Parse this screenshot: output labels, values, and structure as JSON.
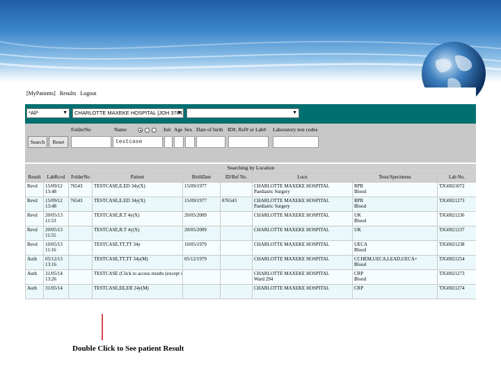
{
  "menu": {
    "items": [
      "[MyPatients]",
      "Results",
      "Logout"
    ]
  },
  "filters": {
    "status_select": "*All*",
    "hospital_select": "CHARLOTTE MAXEKE HOSPITAL [JOH 3784]",
    "third_select": ""
  },
  "search_form": {
    "labels": {
      "folder": "FolderNo",
      "name": "Name",
      "init": "Init",
      "age": "Age",
      "sex": "Sex",
      "dob": "Date of birth",
      "id": "ID#, Ref# or Lab#",
      "tests": "Laboratory test codes"
    },
    "search_button": "Search",
    "reset_button": "Reset",
    "name_value": "testcase"
  },
  "results": {
    "caption": "Searching by Location",
    "columns": [
      "Result",
      "LabRcvd",
      "FolderNo",
      "Patient",
      "BirthDate",
      "ID/Ref No.",
      "Locn",
      "Tests/Specimens",
      "Lab No."
    ],
    "rows": [
      {
        "result": "Revd",
        "rcvd1": "15/09/12",
        "rcvd2": "13:48",
        "folder": "76543",
        "patient": "TESTCASE,E.ED 34y(X)",
        "birth": "15/09/1977",
        "idref": "",
        "locn1": "CHARLOTTE MAXEKE HOSPITAL",
        "locn2": "Paediatric Surgery",
        "tests1": "RPR",
        "tests2": "Blood",
        "lab": "TJG0021072"
      },
      {
        "result": "Revd",
        "rcvd1": "15/09/12",
        "rcvd2": "13:48",
        "folder": "76543",
        "patient": "TESTCASE,E.ED 34y(X)",
        "birth": "15/09/1977",
        "idref": "876543",
        "locn1": "CHARLOTTE MAXEKE HOSPITAL",
        "locn2": "Paediatric Surgery",
        "tests1": "RPR",
        "tests2": "Blood",
        "lab": "TJG0021273"
      },
      {
        "result": "Revd",
        "rcvd1": "20/05/13",
        "rcvd2": "11:53",
        "folder": "",
        "patient": "TESTCASE,R.T 4y(X)",
        "birth": "20/05/2009",
        "idref": "",
        "locn1": "CHARLOTTE MAXEKE HOSPITAL",
        "locn2": "",
        "tests1": "UK",
        "tests2": "Blood",
        "lab": "TJG0021236"
      },
      {
        "result": "Revd",
        "rcvd1": "20/05/13",
        "rcvd2": "11:55",
        "folder": "",
        "patient": "TESTCASE,R.T 4y(X)",
        "birth": "20/05/2009",
        "idref": "",
        "locn1": "CHARLOTTE MAXEKE HOSPITAL",
        "locn2": "",
        "tests1": "UK",
        "tests2": "",
        "lab": "TJG0021237"
      },
      {
        "result": "Revd",
        "rcvd1": "10/05/13",
        "rcvd2": "11:16",
        "folder": "",
        "patient": "TESTCASE,TT,TT 34y",
        "birth": "10/05/1979",
        "idref": "",
        "locn1": "CHARLOTTE MAXEKE HOSPITAL",
        "locn2": "",
        "tests1": "UECA",
        "tests2": "Blood",
        "lab": "TJG0021238"
      },
      {
        "result": "Auth",
        "rcvd1": "05/12/13",
        "rcvd2": "13:16",
        "folder": "",
        "patient": "TESTCASE,TT,TT 34y(M)",
        "birth": "05/12/1979",
        "idref": "",
        "locn1": "CHARLOTTE MAXEKE HOSPITAL",
        "locn2": "",
        "tests1": "CCHEM,UECA,LEAD,UECA+",
        "tests2": "Blood",
        "lab": "TJG0021254"
      },
      {
        "result": "Auth",
        "rcvd1": "31/05/14",
        "rcvd2": "13:26",
        "folder": "",
        "patient": "TESTCASE",
        "patient_note": "(Click to access results (except if status Revd)",
        "birth": "",
        "idref": "",
        "locn1": "CHARLOTTE MAXEKE HOSPITAL",
        "locn2": "Ward 294",
        "tests1": "CRP",
        "tests2": "Blood",
        "lab": "TJG0021273"
      },
      {
        "result": "Auth",
        "rcvd1": "31/05/14",
        "rcvd2": "",
        "folder": "",
        "patient": "TESTCASE,EE,ER 24y(M)",
        "birth": "",
        "idref": "",
        "locn1": "CHARLOTTE MAXEKE HOSPITAL",
        "locn2": "",
        "tests1": "CRP",
        "tests2": "",
        "lab": "TJG0021274"
      }
    ]
  },
  "callout": {
    "text": "Double Click to See patient Result",
    "color": "#d84a4a"
  },
  "colors": {
    "teal_bar": "#006f6f",
    "header_blue": "#1f5ea8",
    "link": "#1a1a9a"
  }
}
